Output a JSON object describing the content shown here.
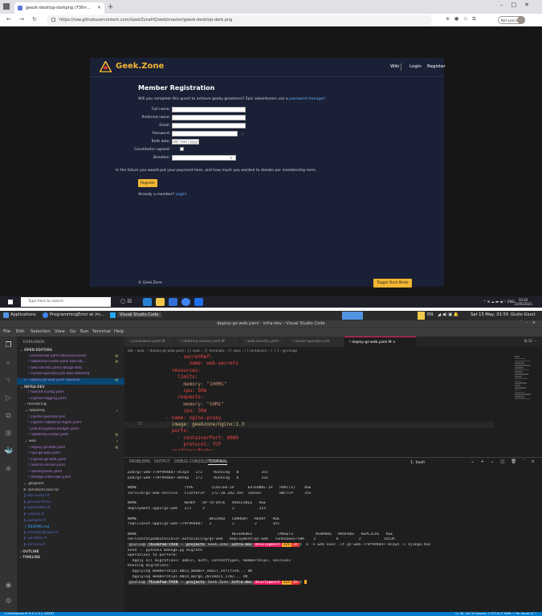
{
  "browser": {
    "tab_title": "geezk-desktop-darkpng (739×…",
    "url": "https://raw.githubusercontent.com/GeekZoneHQ/web/master/geezk-desktop-dark.png",
    "not_syncing": "Not syncing"
  },
  "geekzone": {
    "brand": "Geek.Zone",
    "nav": {
      "wiki": "Wiki",
      "login": "Login",
      "register": "Register"
    },
    "form": {
      "title": "Member Registration",
      "intro_prefix": "Will you complete this quest to achieve geeky greatness? Epic adventurers use a",
      "intro_link": "password manager!",
      "fields": [
        {
          "label": "Full name:",
          "value": ""
        },
        {
          "label": "Preferred name:",
          "value": ""
        },
        {
          "label": "Email:",
          "value": ""
        },
        {
          "label": "Password:",
          "value": ""
        },
        {
          "label": "Birth date:",
          "value": "dd / mm / yyyy"
        },
        {
          "label": "Constitution agreed:",
          "value": ""
        },
        {
          "label": "Donation:",
          "value": ""
        }
      ],
      "future_note": "In the future you would put your payment here, and how much you wanted to donate per membership term.",
      "register_button": "Register",
      "already_prefix": "Already a member?",
      "already_link": "Login!"
    },
    "footer": "© Geek.Zone",
    "toggle_button": "Toggle Dark Mode"
  },
  "taskbar": {
    "search_placeholder": "Type here to search",
    "tray": "^ ⊕ ☁ ▬ ◀ ⚐ ENG",
    "time": "10:20",
    "date": "15/05/2021"
  },
  "linux_panel": {
    "applications": "Applications",
    "window1": "ProgrammingError at /m...",
    "window2": "Visual Studio Code",
    "lang": "EN",
    "datetime": "Sat 15 May, 01:55",
    "user": "Giulio Giunt"
  },
  "vscode": {
    "title": "deploy-gz-web.yaml - infra-dev - Visual Studio Code",
    "menu": [
      "File",
      "Edit",
      "Selection",
      "View",
      "Go",
      "Run",
      "Terminal",
      "Help"
    ],
    "explorer": {
      "header": "EXPLORER",
      "rows": [
        {
          "indent": 4,
          "text": "⌄ OPEN EDITORS",
          "kind": "sec",
          "badge": ""
        },
        {
          "indent": 14,
          "text": "! provisioner.yaml  k8s/provisioner",
          "kind": "yml",
          "badge": "M"
        },
        {
          "indent": 14,
          "text": "! rabbitmq-cluster.yaml  k8s/rab...",
          "kind": "yml",
          "badge": "M"
        },
        {
          "indent": 14,
          "text": "! web-secrets.yaml  k8s/gz-web",
          "kind": "yml",
          "badge": ""
        },
        {
          "indent": 14,
          "text": "! cluster-operator.yml  k8s/rabbitmq",
          "kind": "yml",
          "badge": ""
        },
        {
          "indent": 8,
          "text": "× ! deploy-gz-web.yaml  k8s/web",
          "kind": "yml",
          "badge": "M"
        },
        {
          "indent": 4,
          "text": "⌄ INFRA-DEV",
          "kind": "sec",
          "badge": ""
        },
        {
          "indent": 14,
          "text": "! fluentd-config.yaml",
          "kind": "yml",
          "badge": ""
        },
        {
          "indent": 14,
          "text": "! ingress-logging.yaml",
          "kind": "yml",
          "badge": ""
        },
        {
          "indent": 10,
          "text": "› monitoring",
          "kind": "",
          "badge": ""
        },
        {
          "indent": 10,
          "text": "⌄ rabbitmq",
          "kind": "",
          "badge": "•"
        },
        {
          "indent": 14,
          "text": "! cluster-operator.yml",
          "kind": "yml",
          "badge": ""
        },
        {
          "indent": 14,
          "text": "! ingress-rabbitmq-mgmt.yaml",
          "kind": "yml",
          "badge": ""
        },
        {
          "indent": 14,
          "text": "! pod-disruption-budget.yaml",
          "kind": "yml",
          "badge": ""
        },
        {
          "indent": 14,
          "text": "! rabbitmq-cluster.yaml",
          "kind": "yml",
          "badge": "M"
        },
        {
          "indent": 10,
          "text": "⌄ web",
          "kind": "",
          "badge": "•"
        },
        {
          "indent": 14,
          "text": "! deploy-gz-web.yaml",
          "kind": "yml",
          "badge": "M"
        },
        {
          "indent": 14,
          "text": "! hpa-gz-web.yaml",
          "kind": "yml",
          "badge": ""
        },
        {
          "indent": 14,
          "text": "! ingress-gz-web.yaml",
          "kind": "yml",
          "badge": ""
        },
        {
          "indent": 14,
          "text": "! metrics-server.yaml",
          "kind": "yml",
          "badge": ""
        },
        {
          "indent": 14,
          "text": "! namespaces.yaml",
          "kind": "yml",
          "badge": ""
        },
        {
          "indent": 14,
          "text": "! storage-class-aws.yaml",
          "kind": "yml",
          "badge": ""
        },
        {
          "indent": 8,
          "text": "⌄ .gitignore",
          "kind": "",
          "badge": ""
        },
        {
          "indent": 8,
          "text": "≡ .terraform.lock.hcl",
          "kind": "",
          "badge": ""
        },
        {
          "indent": 8,
          "text": "❯ eks-cluster.tf",
          "kind": "tf",
          "badge": ""
        },
        {
          "indent": 8,
          "text": "❯ gz-auto.tfvars",
          "kind": "tf",
          "badge": ""
        },
        {
          "indent": 8,
          "text": "❯ kubernetes.tf",
          "kind": "tf",
          "badge": ""
        },
        {
          "indent": 8,
          "text": "❯ outputs.tf",
          "kind": "tf",
          "badge": ""
        },
        {
          "indent": 8,
          "text": "❯ postgres.tf",
          "kind": "tf",
          "badge": ""
        },
        {
          "indent": 8,
          "text": "ⓘ README.md",
          "kind": "md",
          "badge": ""
        },
        {
          "indent": 8,
          "text": "❯ security-groups.tf",
          "kind": "tf",
          "badge": ""
        },
        {
          "indent": 8,
          "text": "❯ variables.tf",
          "kind": "tf",
          "badge": ""
        },
        {
          "indent": 8,
          "text": "❯ versions.tf",
          "kind": "tf",
          "badge": ""
        },
        {
          "indent": 4,
          "text": "› OUTLINE",
          "kind": "sec",
          "badge": ""
        },
        {
          "indent": 4,
          "text": "› TIMELINE",
          "kind": "sec",
          "badge": ""
        }
      ]
    },
    "tabs": [
      {
        "label": "! provisioner.yaml M",
        "active": false
      },
      {
        "label": "! rabbitmq-cluster.yaml M",
        "active": false
      },
      {
        "label": "! web-secrets.yaml",
        "active": false
      },
      {
        "label": "! cluster-operator.yml",
        "active": false
      },
      {
        "label": "! deploy-gz-web.yaml M ×",
        "active": true
      }
    ],
    "breadcrumb": "k8s › web › ! deploy-gz-web.yaml › {} spec › {} template › {} spec › [ ] containers › { } 1 › ▤ image",
    "code": [
      {
        "n": "",
        "t": "          - secretRef:",
        "c": "k"
      },
      {
        "n": "",
        "t": "              name: web-secrets",
        "c": "k"
      },
      {
        "n": "",
        "t": "        resources:",
        "c": "k"
      },
      {
        "n": "",
        "t": "          limits:",
        "c": "k"
      },
      {
        "n": "",
        "t": "            memory: \"100Mi\"",
        "c": "s"
      },
      {
        "n": "",
        "t": "            cpu: 50m",
        "c": "k"
      },
      {
        "n": "",
        "t": "          requests:",
        "c": "k"
      },
      {
        "n": "",
        "t": "            memory: \"50Mi\"",
        "c": "s"
      },
      {
        "n": "",
        "t": "            cpu: 30m",
        "c": "k"
      },
      {
        "n": "",
        "t": "      - name: nginx-proxy",
        "c": "k"
      },
      {
        "n": "30",
        "t": "        image: geekzone/nginx:1.3",
        "c": "v"
      },
      {
        "n": "",
        "t": "        ports:",
        "c": "k"
      },
      {
        "n": "",
        "t": "          - containerPort: 8080",
        "c": "k"
      },
      {
        "n": "",
        "t": "            protocol: TCP",
        "c": "k"
      },
      {
        "n": "",
        "t": "        readinessProbe:",
        "c": "k"
      },
      {
        "n": "",
        "t": "          tcpSocket:",
        "c": "k"
      }
    ],
    "terminal": {
      "tabs": [
        "PROBLEMS",
        "OUTPUT",
        "DEBUG CONSOLE",
        "TERMINAL"
      ],
      "selector": "1: bash",
      "lines": [
        "pod/gz-web-779f994bd7-dczp4   2/2     Running   0          35s",
        "pod/gz-web-779f994bd7-mmtkp   2/2     Running   0          33s",
        "",
        "NAME                     TYPE        CLUSTER-IP      EXTERNAL-IP   PORT(S)    AGE",
        "service/gz-web-service   ClusterIP   172.20.202.193  <none>        80/TCP     35s",
        "",
        "NAME                     READY   UP-TO-DATE   AVAILABLE   AGE",
        "deployment.apps/gz-web   2/2     2            2           35s",
        "",
        "NAME                                DESIRED   CURRENT   READY   AGE",
        "replicaset.apps/gz-web-779f994bd7   2         2         2       35s",
        "",
        "NAME                                          REFERENCE           TARGETS          MINPODS   MAXPODS   REPLICAS   AGE",
        "horizontalpodautoscaler.autoscaling/gz-web   Deployment/gz-web   <unknown>/50%    2         6         2          5d13h"
      ],
      "prompt1": {
        "a": "giulio@",
        "b": "ThinkPad-T430",
        "c": "~",
        "d": "projects",
        "e": "Geek.Zone",
        "f": "infra-dev",
        "g": "development",
        "h": "12s",
        "i": "3+",
        "cmd": "$  k -n web exec -it gz-web-779f994bd7-dczp4 -c django-bac"
      },
      "after": [
        "kend -- python3 manage.py migrate",
        "Operations to perform:",
        "  Apply all migrations: admin, auth, contenttypes, memberships, sessions",
        "Running migrations:",
        "  Applying memberships.0012_member_email_verified... OK",
        "  Applying memberships.0014_merge_20210421_1702... OK"
      ],
      "prompt2": {
        "a": "giulio@",
        "b": "ThinkPad-T430",
        "c": "~",
        "d": "projects",
        "e": "Geek.Zone",
        "f": "infra-dev",
        "g": "development",
        "h": "12s",
        "i": "3+",
        "cmd": "$ "
      }
    },
    "status": {
      "left": "⎇ development*   ⊗ 0 ⚠ 0   ▷ AGENT",
      "right": "Ln 30, Col 34   Spaces: 2   UTF-8   LF   YAML   ⚇ No issues   ☺ ⚐"
    }
  },
  "colors": {
    "brand_yellow": "#f2b632",
    "gz_bg": "#1a2035",
    "vscode_blue": "#007acc",
    "pink": "#e91e63"
  }
}
